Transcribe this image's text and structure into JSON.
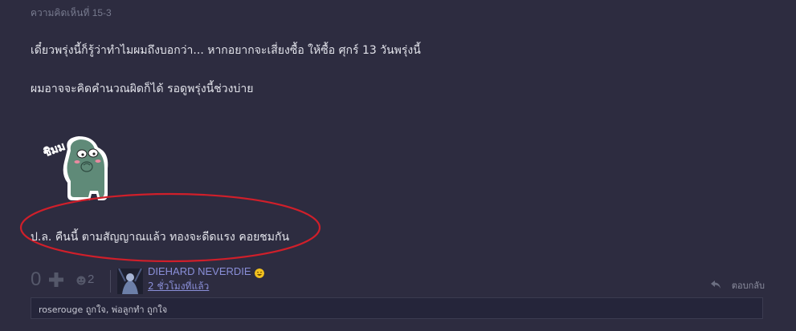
{
  "comment": {
    "number_label": "ความคิดเห็นที่ 15-3",
    "lines": [
      "เดี๋ยวพรุ่งนี้ก็รู้ว่าทำไมผมถึงบอกว่า... หากอยากจะเสี่ยงซื้อ ให้ซื้อ ศุกร์ 13 วันพรุ่งนี้",
      "ผมอาจจะคิดคำนวณผิดก็ได้ รอดูพรุ่งนี้ช่วงบ่าย",
      "ป.ล. คืนนี้ ตามสัญญาณแล้ว ทองจะดีดแรง คอยชมกัน"
    ],
    "sticker": {
      "text": "ชิมม"
    },
    "highlight_color": "#d01f2a"
  },
  "footer": {
    "score": "0",
    "emotion_count": "2",
    "username": "DIEHARD NEVERDIE",
    "time": "2 ชั่วโมงที่แล้ว",
    "reply_label": "ตอบกลับ"
  },
  "likes": {
    "text": "roserouge ถูกใจ, พ่อลูกทำ ถูกใจ"
  },
  "icons": {
    "plus": "plus-icon",
    "emotion": "emotion-face-icon",
    "badge": "laughing-face-icon",
    "reply": "reply-arrow-icon"
  }
}
